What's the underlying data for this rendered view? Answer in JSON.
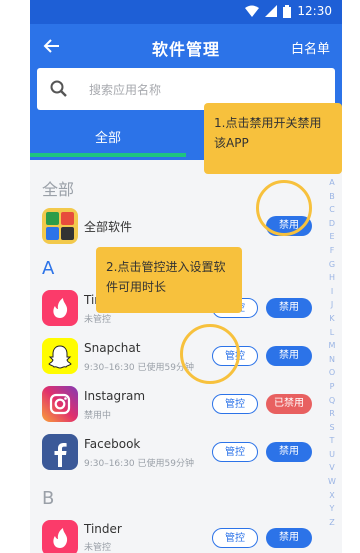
{
  "status_bar": {
    "time": "12:30"
  },
  "header": {
    "title": "软件管理",
    "whitelist_label": "白名单"
  },
  "search": {
    "placeholder": "搜索应用名称"
  },
  "tabs": [
    {
      "label": "全部"
    }
  ],
  "sections": {
    "all": "全部",
    "a": "A",
    "b": "B"
  },
  "all_software": {
    "name": "全部软件",
    "disable_label": "禁用"
  },
  "apps": [
    {
      "name": "Tinder",
      "sub": "未管控",
      "manage_label": "管控",
      "disable_label": "禁用",
      "icon": "tinder-icon",
      "color": "#fb3b6a"
    },
    {
      "name": "Snapchat",
      "sub": "9:30–16:30  已使用59分钟",
      "manage_label": "管控",
      "disable_label": "禁用",
      "icon": "snapchat-icon",
      "color": "#fffc00"
    },
    {
      "name": "Instagram",
      "sub": "禁用中",
      "manage_label": "管控",
      "disable_label": "已禁用",
      "icon": "instagram-icon",
      "color": "#d6249f"
    },
    {
      "name": "Facebook",
      "sub": "9:30–16:30  已使用59分钟",
      "manage_label": "管控",
      "disable_label": "禁用",
      "icon": "facebook-icon",
      "color": "#3b5998"
    },
    {
      "name": "Tinder",
      "sub": "未管控",
      "manage_label": "管控",
      "disable_label": "禁用",
      "icon": "tinder-icon",
      "color": "#fb3b6a"
    }
  ],
  "alphabet": [
    "A",
    "B",
    "C",
    "D",
    "E",
    "F",
    "G",
    "H",
    "I",
    "J",
    "K",
    "L",
    "M",
    "N",
    "O",
    "P",
    "Q",
    "R",
    "S",
    "T",
    "U",
    "V",
    "W",
    "X",
    "Y",
    "Z"
  ],
  "tooltips": {
    "tip1": "1.点击禁用开关禁用该APP",
    "tip2": "2.点击管控进入设置软件可用时长"
  },
  "colors": {
    "primary": "#2c73e8",
    "accent_green": "#1ec47f",
    "tooltip": "#f7c13d",
    "disabled_red": "#e86060"
  }
}
